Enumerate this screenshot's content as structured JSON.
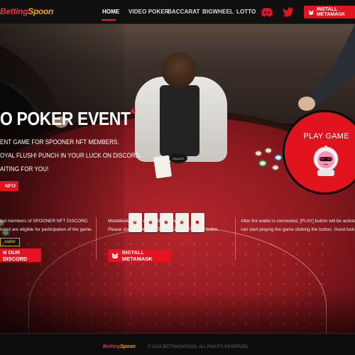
{
  "header": {
    "logo_part1": "Betting",
    "logo_part2": "Spoon",
    "nav": [
      {
        "label": "HOME",
        "active": true
      },
      {
        "label": "VIDEO POKER",
        "active": false
      },
      {
        "label": "BACCARAT",
        "active": false
      },
      {
        "label": "BIGWHEEL",
        "active": false
      },
      {
        "label": "LOTTO",
        "active": false
      }
    ],
    "install_button": "INSTALL METAMASK",
    "social_icons": [
      "discord-icon",
      "twitter-icon"
    ]
  },
  "hero": {
    "title": "O POKER EVENT",
    "title_star": "*",
    "lines": [
      "ENT GAME FOR SPOONER NFT MEMBERS.",
      "OYAL FLUSH! PUNCH IN YOUR LUCK ON DISCORD.",
      "AITING FOR YOU!"
    ],
    "info_button": "NFO"
  },
  "play_game": {
    "label": "PLAY GAME",
    "icon": "astronaut-icon"
  },
  "steps": [
    {
      "lines": [
        "ted members of SPOONER NFT DISCORD",
        "listed are eligible for participation of the game."
      ],
      "button": "N OUR DISCORD",
      "tag": "_wallet"
    },
    {
      "lines": [
        "MetaMask wallet connection is required.",
        "Please install MetaMask before connecting your wallet."
      ],
      "button": "INSTALL METAMASK"
    },
    {
      "lines": [
        "After the wallet is connected, [PLAY] button will be activated. You",
        "can start playing the game clicking the button. Good luck!"
      ]
    }
  ],
  "scene": {
    "dealer_button": "DEALER"
  },
  "footer": {
    "logo_part1": "Betting",
    "logo_part2": "Spoon",
    "copyright": "© 2022 BETTINGSPOON. ALL RIGHTS RESERVED."
  },
  "colors": {
    "accent": "#e3141f",
    "logo_red": "#e8323c",
    "logo_orange": "#f1a21a"
  }
}
